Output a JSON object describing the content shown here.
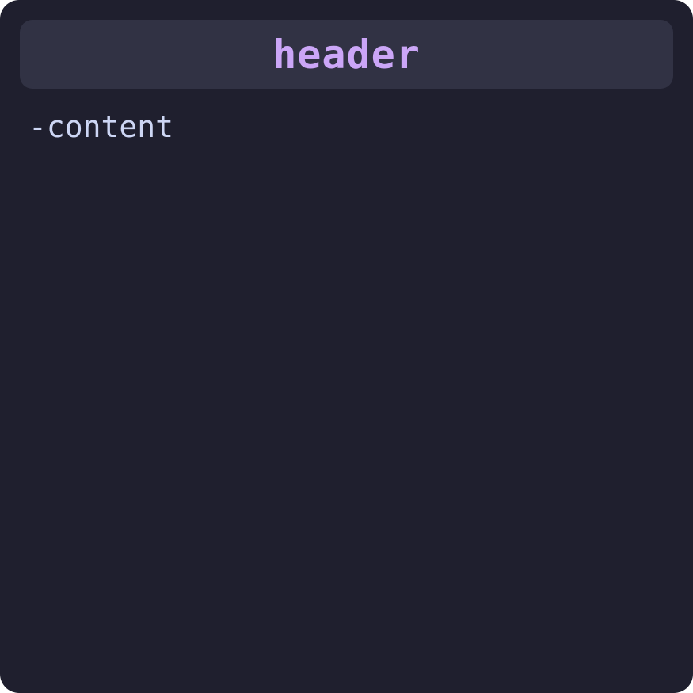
{
  "header": {
    "title": "header"
  },
  "main": {
    "content_text": "-content"
  },
  "colors": {
    "window_background": "#1f1f2e",
    "header_background": "#313244",
    "header_text": "#cba6f7",
    "content_text": "#cdd6f4"
  }
}
